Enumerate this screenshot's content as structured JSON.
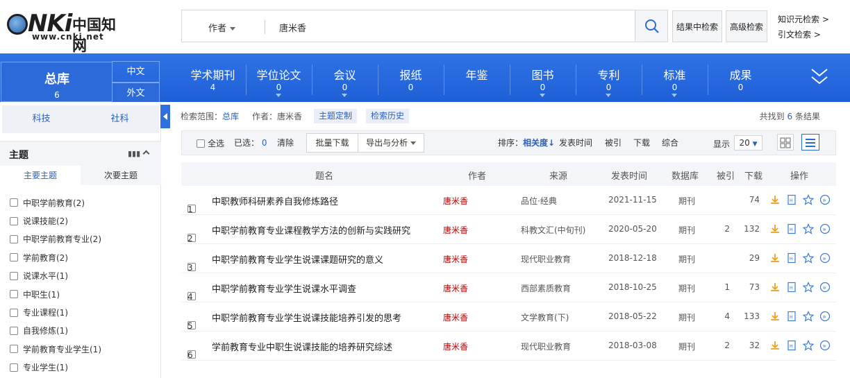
{
  "header": {
    "logo_text": "CNKi中国知网",
    "logo_url": "www.cnki.net",
    "search_field": "作者",
    "search_value": "唐米香",
    "btn_in_results": "结果中检索",
    "btn_advanced": "高级检索",
    "link_knowledge": "知识元检索 >",
    "link_citation": "引文检索 >"
  },
  "nav": {
    "zongku_label": "总库",
    "zongku_count": "6",
    "lang_cn": "中文",
    "lang_en": "外文",
    "items": [
      {
        "label": "学术期刊",
        "count": "4"
      },
      {
        "label": "学位论文",
        "count": "0"
      },
      {
        "label": "会议",
        "count": "0"
      },
      {
        "label": "报纸",
        "count": "0"
      },
      {
        "label": "年鉴",
        "count": ""
      },
      {
        "label": "图书",
        "count": "0"
      },
      {
        "label": "专利",
        "count": "0"
      },
      {
        "label": "标准",
        "count": "0"
      },
      {
        "label": "成果",
        "count": "0"
      }
    ]
  },
  "sidebar": {
    "tab_sci": "科技",
    "tab_social": "社科",
    "facet_title": "主题",
    "sub_main": "主要主题",
    "sub_secondary": "次要主题",
    "facets": [
      "中职学前教育(2)",
      "说课技能(2)",
      "中职学前教育专业(2)",
      "学前教育(2)",
      "说课水平(1)",
      "中职生(1)",
      "专业课程(1)",
      "自我修炼(1)",
      "学前教育专业学生(1)",
      "专业学生(1)"
    ]
  },
  "results": {
    "scope_label": "检索范围：",
    "scope_value": "总库",
    "author_filter": "作者：唐米香",
    "theme_custom": "主题定制",
    "history": "检索历史",
    "found_prefix": "共找到",
    "found_count": "6",
    "found_suffix": "条结果",
    "select_all": "全选",
    "selected_label": "已选：",
    "selected_count": "0",
    "clear": "清除",
    "batch_download": "批量下载",
    "export": "导出与分析",
    "sort_label": "排序：",
    "sort_relevance": "相关度",
    "sort_date": "发表时间",
    "sort_cited": "被引",
    "sort_download": "下载",
    "sort_combined": "综合",
    "show_label": "显示",
    "page_size": "20",
    "columns": [
      "题名",
      "作者",
      "来源",
      "发表时间",
      "数据库",
      "被引",
      "下载",
      "操作"
    ],
    "rows": [
      {
        "idx": "1",
        "title": "中职教师科研素养自我修炼路径",
        "author": "唐米香",
        "source": "品位·经典",
        "date": "2021-11-15",
        "db": "期刊",
        "cited": "",
        "downloads": "74"
      },
      {
        "idx": "2",
        "title": "中职学前教育专业课程教学方法的创新与实践研究",
        "author": "唐米香",
        "source": "科教文汇(中旬刊)",
        "date": "2020-05-20",
        "db": "期刊",
        "cited": "2",
        "downloads": "132"
      },
      {
        "idx": "3",
        "title": "中职学前教育专业学生说课课题研究的意义",
        "author": "唐米香",
        "source": "现代职业教育",
        "date": "2018-12-18",
        "db": "期刊",
        "cited": "",
        "downloads": "29"
      },
      {
        "idx": "4",
        "title": "中职学前教育专业学生说课水平调查",
        "author": "唐米香",
        "source": "西部素质教育",
        "date": "2018-10-25",
        "db": "期刊",
        "cited": "1",
        "downloads": "73"
      },
      {
        "idx": "5",
        "title": "中职学前教育专业学生说课技能培养引发的思考",
        "author": "唐米香",
        "source": "文学教育(下)",
        "date": "2018-05-22",
        "db": "期刊",
        "cited": "4",
        "downloads": "133"
      },
      {
        "idx": "6",
        "title": "学前教育专业中职生说课技能的培养研究综述",
        "author": "唐米香",
        "source": "现代职业教育",
        "date": "2018-03-08",
        "db": "期刊",
        "cited": "2",
        "downloads": "32"
      }
    ]
  },
  "colors": {
    "nav_blue": "#2f73e6",
    "link_blue": "#2b5fc0",
    "author_red": "#c00000",
    "download_orange": "#f0a020"
  }
}
